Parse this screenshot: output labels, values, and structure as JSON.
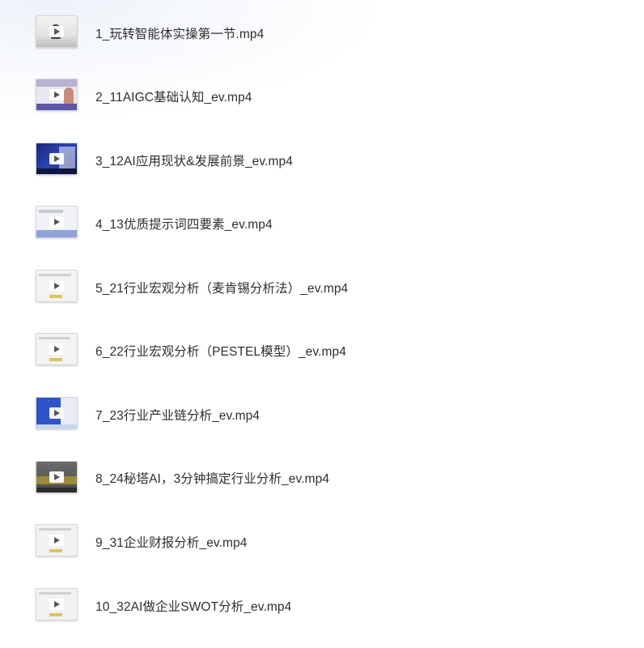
{
  "files": [
    {
      "name": "1_玩转智能体实操第一节.mp4",
      "thumbnail_icon": "video-thumbnail"
    },
    {
      "name": "2_11AIGC基础认知_ev.mp4",
      "thumbnail_icon": "video-thumbnail"
    },
    {
      "name": "3_12AI应用现状&发展前景_ev.mp4",
      "thumbnail_icon": "video-thumbnail"
    },
    {
      "name": "4_13优质提示词四要素_ev.mp4",
      "thumbnail_icon": "video-thumbnail"
    },
    {
      "name": "5_21行业宏观分析（麦肯锡分析法）_ev.mp4",
      "thumbnail_icon": "video-thumbnail"
    },
    {
      "name": "6_22行业宏观分析（PESTEL模型）_ev.mp4",
      "thumbnail_icon": "video-thumbnail"
    },
    {
      "name": "7_23行业产业链分析_ev.mp4",
      "thumbnail_icon": "video-thumbnail"
    },
    {
      "name": "8_24秘塔AI，3分钟搞定行业分析_ev.mp4",
      "thumbnail_icon": "video-thumbnail"
    },
    {
      "name": "9_31企业财报分析_ev.mp4",
      "thumbnail_icon": "video-thumbnail"
    },
    {
      "name": "10_32AI做企业SWOT分析_ev.mp4",
      "thumbnail_icon": "video-thumbnail"
    }
  ]
}
